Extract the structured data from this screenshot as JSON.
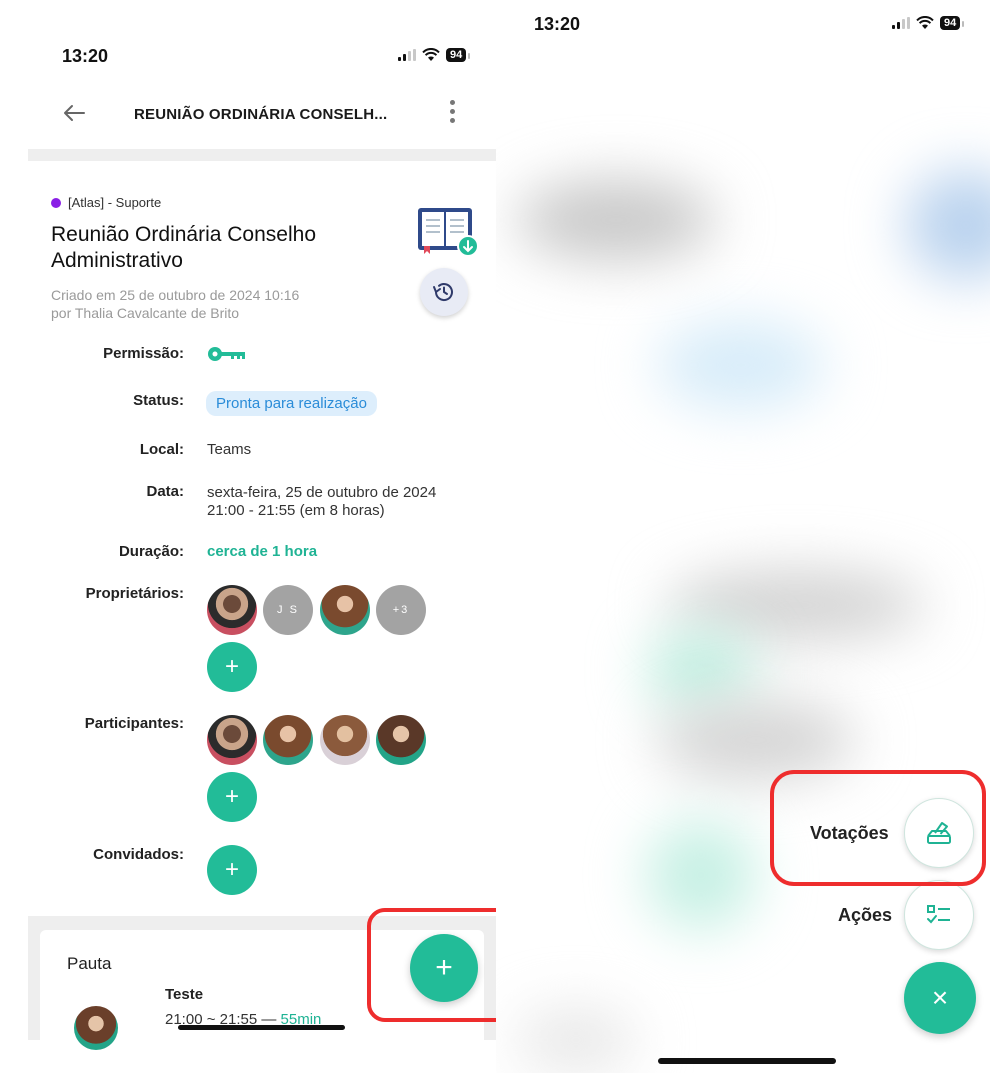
{
  "left_screen": {
    "status_bar": {
      "time": "13:20",
      "battery": "94"
    },
    "nav": {
      "title": "REUNIÃO ORDINÁRIA CONSELH..."
    },
    "meeting": {
      "organization": "[Atlas] - Suporte",
      "title": "Reunião Ordinária Conselho Administrativo",
      "created_line1": "Criado em 25 de outubro de 2024 10:16",
      "created_line2": "por Thalia Cavalcante de Brito"
    },
    "details": {
      "permission_label": "Permissão:",
      "status_label": "Status:",
      "status_value": "Pronta para realização",
      "local_label": "Local:",
      "local_value": "Teams",
      "date_label": "Data:",
      "date_line1": "sexta-feira, 25 de outubro de 2024",
      "date_line2": "21:00 - 21:55 (em 8 horas)",
      "duration_label": "Duração:",
      "duration_value": "cerca de 1 hora",
      "owners_label": "Proprietários:",
      "owners_initials": "J S",
      "owners_more": "+3",
      "participants_label": "Participantes:",
      "guests_label": "Convidados:",
      "add_symbol": "+"
    },
    "pauta": {
      "title": "Pauta",
      "item_title": "Teste",
      "item_time": "21:00 ~ 21:55 — ",
      "item_duration": "55min",
      "fab_symbol": "+"
    }
  },
  "right_screen": {
    "status_bar": {
      "time": "13:20",
      "battery": "94"
    },
    "fab_menu": {
      "votes_label": "Votações",
      "actions_label": "Ações",
      "close_symbol": "×"
    }
  },
  "colors": {
    "accent": "#22bc98",
    "highlight": "#ee2d2d",
    "status_pill_bg": "#ddeefc",
    "status_pill_text": "#2a8cd8",
    "org_dot": "#8a1fe6"
  }
}
